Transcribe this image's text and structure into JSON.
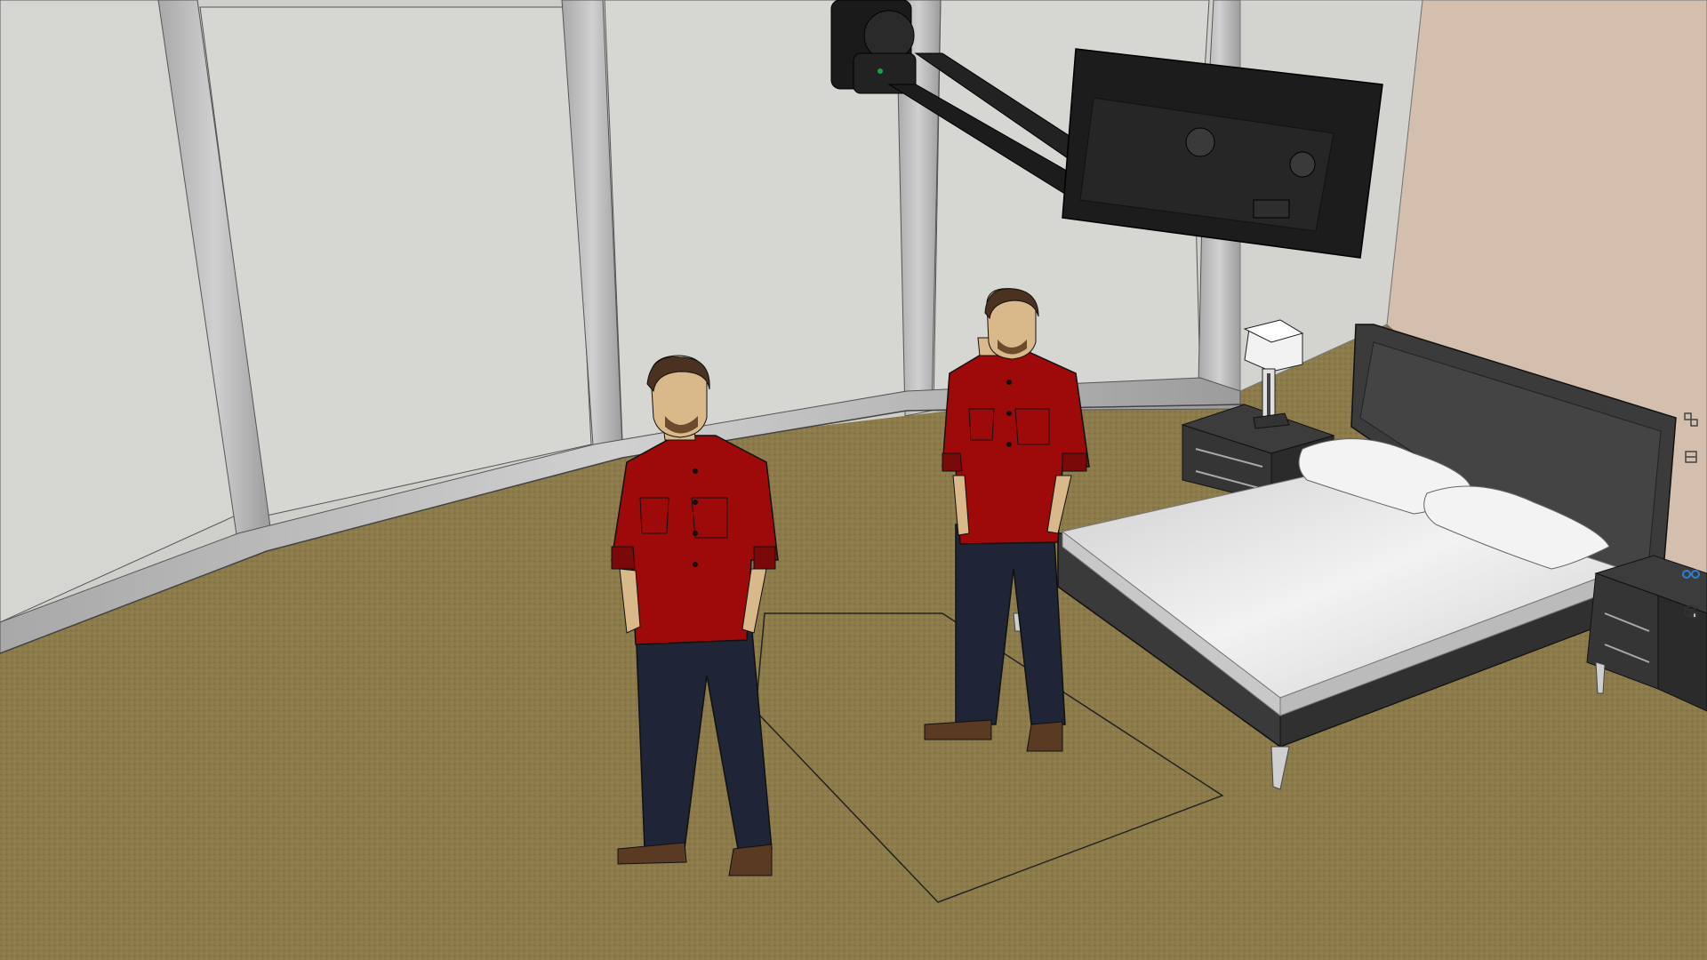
{
  "app": {
    "tool_icons": [
      "components-icon",
      "styles-icon",
      "glasses-icon",
      "entity-info-icon"
    ]
  },
  "colors": {
    "floor": "#8a7a4a",
    "wall": "#d3d3d0",
    "accent_wall": "#d4bfae",
    "frame": "#b9b9b9",
    "shirt": "#9e0a0a",
    "pants": "#1f2436",
    "skin": "#d9b88a",
    "bed_frame": "#3e3e3e",
    "mattress": "#ececec",
    "tv": "#1c1c1c",
    "panel_icon_blue": "#2d7fd1"
  }
}
